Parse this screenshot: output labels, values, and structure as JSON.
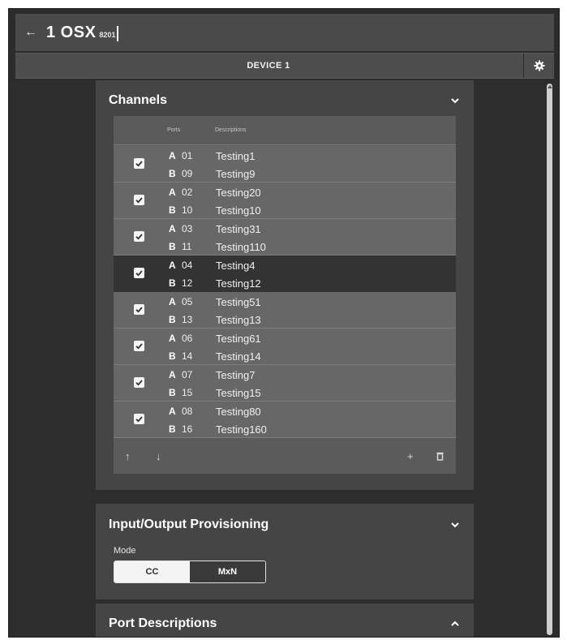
{
  "header": {
    "title": "1 OSX",
    "subtitle": "8201",
    "back_icon": "arrow-left-icon"
  },
  "tabbar": {
    "tab_label": "DEVICE 1",
    "settings_icon": "gear-icon"
  },
  "channels": {
    "title": "Channels",
    "columns": {
      "ports": "Ports",
      "descriptions": "Descriptions"
    },
    "rows": [
      {
        "checked": true,
        "a_letter": "A",
        "a_port": "01",
        "a_desc": "Testing1",
        "b_letter": "B",
        "b_port": "09",
        "b_desc": "Testing9"
      },
      {
        "checked": true,
        "a_letter": "A",
        "a_port": "02",
        "a_desc": "Testing20",
        "b_letter": "B",
        "b_port": "10",
        "b_desc": "Testing10"
      },
      {
        "checked": true,
        "a_letter": "A",
        "a_port": "03",
        "a_desc": "Testing31",
        "b_letter": "B",
        "b_port": "11",
        "b_desc": "Testing110"
      },
      {
        "checked": true,
        "selected": true,
        "a_letter": "A",
        "a_port": "04",
        "a_desc": "Testing4",
        "b_letter": "B",
        "b_port": "12",
        "b_desc": "Testing12"
      },
      {
        "checked": true,
        "a_letter": "A",
        "a_port": "05",
        "a_desc": "Testing51",
        "b_letter": "B",
        "b_port": "13",
        "b_desc": "Testing13"
      },
      {
        "checked": true,
        "a_letter": "A",
        "a_port": "06",
        "a_desc": "Testing61",
        "b_letter": "B",
        "b_port": "14",
        "b_desc": "Testing14"
      },
      {
        "checked": true,
        "a_letter": "A",
        "a_port": "07",
        "a_desc": "Testing7",
        "b_letter": "B",
        "b_port": "15",
        "b_desc": "Testing15"
      },
      {
        "checked": true,
        "a_letter": "A",
        "a_port": "08",
        "a_desc": "Testing80",
        "b_letter": "B",
        "b_port": "16",
        "b_desc": "Testing160"
      }
    ],
    "footer": {
      "move_up": "↑",
      "move_down": "↓",
      "add": "+"
    }
  },
  "io": {
    "title": "Input/Output Provisioning",
    "mode_label": "Mode",
    "options": [
      "CC",
      "MxN"
    ],
    "selected": "CC"
  },
  "port_descriptions": {
    "title": "Port Descriptions"
  },
  "colors": {
    "background": "#2d2d2d",
    "panel": "#454545",
    "row": "#676767",
    "row_selected": "#333333"
  }
}
